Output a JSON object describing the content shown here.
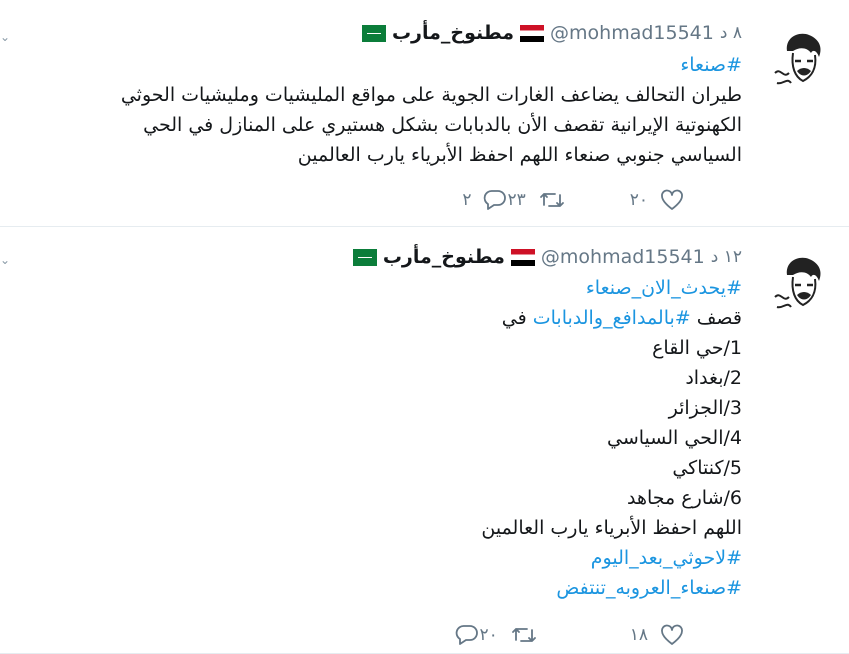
{
  "tweets": [
    {
      "author": {
        "name": "مطنوخ_مأرب",
        "handle": "@mohmad15541"
      },
      "time": "٨ د",
      "hashtag_line": "#صنعاء",
      "lines": [
        "طيران التحالف يضاعف الغارات الجوية على مواقع المليشيات ومليشيات الحوثي",
        "الكهنوتية الإيرانية تقصف الأن بالدبابات بشكل هستيري على المنازل في الحي",
        "السياسي جنوبي صنعاء اللهم احفظ الأبرياء يارب العالمين"
      ],
      "actions": {
        "replies": "٢",
        "retweets": "٢٣",
        "likes": "٢٠"
      }
    },
    {
      "author": {
        "name": "مطنوخ_مأرب",
        "handle": "@mohmad15541"
      },
      "time": "١٢ د",
      "hashtag_line": "#يحدث_الان_صنعاء",
      "line2": {
        "prefix": "قصف ",
        "hashtag": "#بالمدافع_والدبابات",
        "suffix": " في"
      },
      "list": [
        "1/حي القاع",
        "2/بغداد",
        "3/الجزائر",
        "4/الحي السياسي",
        "5/كنتاكي",
        "6/شارع مجاهد"
      ],
      "prayer": "اللهم احفظ الأبرياء يارب العالمين",
      "tags": [
        "#لاحوثي_بعد_اليوم",
        "#صنعاء_العروبه_تنتفض"
      ],
      "actions": {
        "replies": "",
        "retweets": "٢٠",
        "likes": "١٨"
      }
    }
  ],
  "icons": {
    "reply": "reply-icon",
    "retweet": "retweet-icon",
    "like": "heart-icon",
    "more": "chevron-down-icon"
  },
  "colors": {
    "link": "#1b95e0",
    "muted": "#657786",
    "divider": "#e6ecf0"
  }
}
